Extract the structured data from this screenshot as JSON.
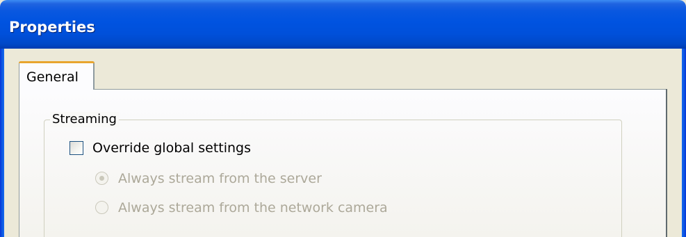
{
  "window": {
    "title": "Properties"
  },
  "tabs": [
    {
      "label": "General",
      "selected": true
    }
  ],
  "streaming_group": {
    "title": "Streaming",
    "override_checkbox": {
      "label": "Override global settings",
      "checked": false
    },
    "radio_options": [
      {
        "label": "Always stream from the server",
        "selected": true,
        "enabled": false
      },
      {
        "label": "Always stream from the network camera",
        "selected": false,
        "enabled": false
      }
    ]
  },
  "colors": {
    "titlebar": "#0053E0",
    "dialog_background": "#ECE9D8",
    "tab_highlight": "#E8A52E",
    "disabled_text": "#ACA899"
  }
}
